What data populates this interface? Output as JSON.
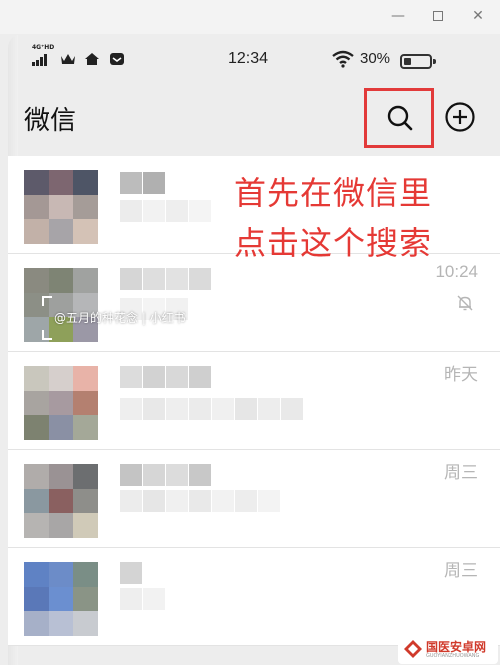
{
  "window": {
    "minimize_glyph": "—",
    "close_glyph": "✕"
  },
  "statusbar": {
    "network_tag": "4G⁺HD",
    "time": "12:34",
    "battery_text": "30%",
    "battery_level_percent": 30,
    "icons": [
      "signal-icon",
      "crown-icon",
      "home-icon",
      "message-icon",
      "wifi-icon",
      "battery-icon"
    ]
  },
  "header": {
    "title": "微信",
    "icons": [
      "search-icon",
      "plus-circle-icon"
    ],
    "highlight_color": "#e23a3a"
  },
  "annotation": {
    "line1": "首先在微信里",
    "line2": "点击这个搜索",
    "color": "#e53935"
  },
  "chats": [
    {
      "time": ""
    },
    {
      "time": "10:24",
      "muted": true
    },
    {
      "time": "昨天"
    },
    {
      "time": "周三"
    },
    {
      "time": "周三"
    }
  ],
  "watermark": {
    "text": "@五月的种花念 | 小红书"
  },
  "site_logo": {
    "name": "国医安卓网",
    "sub": "GUOYIANZHUOWANG"
  }
}
